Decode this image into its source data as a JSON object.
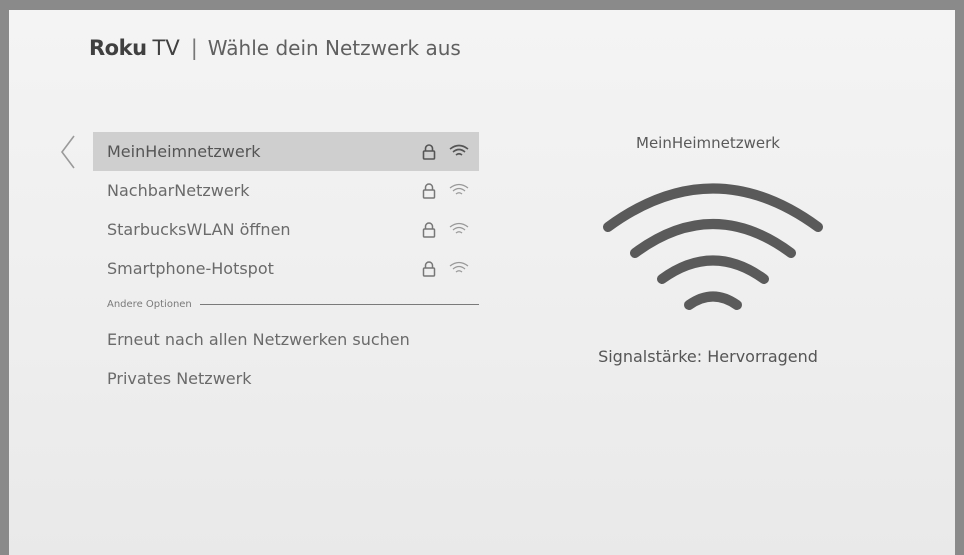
{
  "header": {
    "brand": "Roku",
    "brand_suffix": "TV",
    "separator": "|",
    "title": "Wähle dein Netzwerk aus"
  },
  "networks": [
    {
      "name": "MeinHeimnetzwerk",
      "icons": [
        "lock-icon",
        "wifi-icon"
      ],
      "selected": true
    },
    {
      "name": "NachbarNetzwerk",
      "icons": [
        "lock-icon",
        "wifi-icon"
      ],
      "selected": false
    },
    {
      "name": "StarbucksWLAN öffnen",
      "icons": [
        "lock-icon",
        "wifi-icon"
      ],
      "selected": false
    },
    {
      "name": "Smartphone-Hotspot",
      "icons": [
        "lock-icon",
        "wifi-icon"
      ],
      "selected": false
    }
  ],
  "other_options": {
    "heading": "Andere Optionen",
    "items": [
      {
        "label": "Erneut nach allen Netzwerken suchen"
      },
      {
        "label": "Privates Netzwerk"
      }
    ]
  },
  "detail": {
    "network_name": "MeinHeimnetzwerk",
    "signal_text": "Signalstärke: Hervorragend",
    "signal_level": 1.0
  },
  "colors": {
    "background": "#efefef",
    "selection": "#cfcfcf",
    "text": "#6a6a6a"
  }
}
